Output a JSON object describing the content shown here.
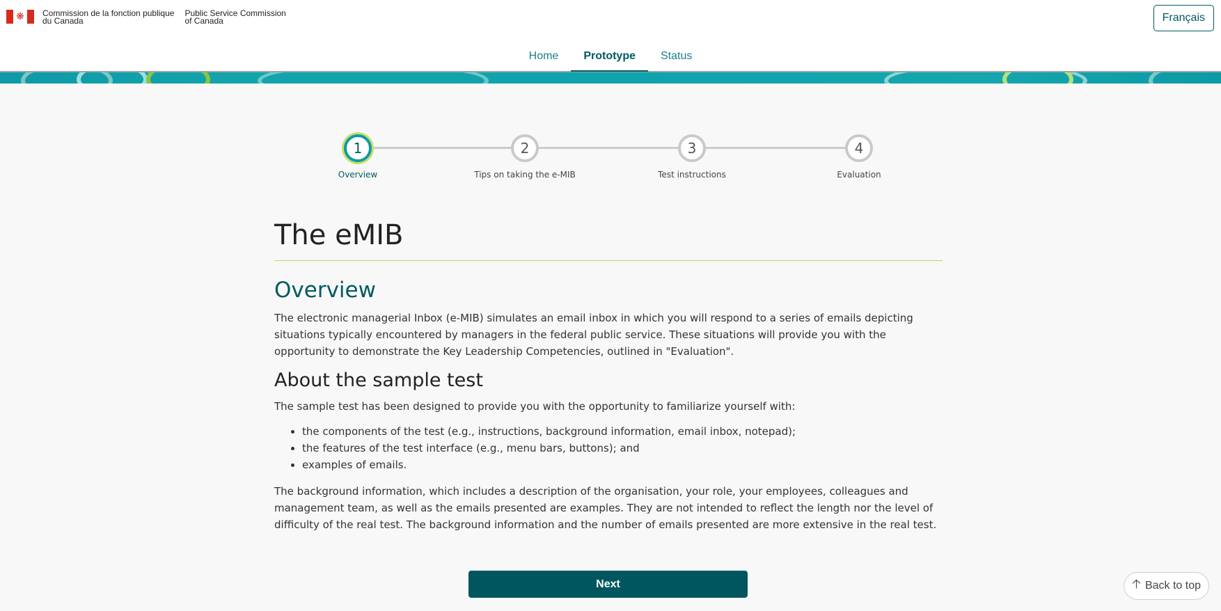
{
  "header": {
    "org_fr": "Commission de la fonction publique\ndu Canada",
    "org_en": "Public Service Commission\nof Canada",
    "flag_icon": "canada-flag-icon",
    "language_button": "Français"
  },
  "nav": {
    "tabs": [
      {
        "label": "Home",
        "active": false
      },
      {
        "label": "Prototype",
        "active": true
      },
      {
        "label": "Status",
        "active": false
      }
    ]
  },
  "stepper": {
    "current": 1,
    "steps": [
      {
        "number": "1",
        "label": "Overview"
      },
      {
        "number": "2",
        "label": "Tips on taking the e-MIB"
      },
      {
        "number": "3",
        "label": "Test instructions"
      },
      {
        "number": "4",
        "label": "Evaluation"
      }
    ]
  },
  "main": {
    "title": "The eMIB",
    "overview_heading": "Overview",
    "overview_text": "The electronic managerial Inbox (e-MIB) simulates an email inbox in which you will respond to a series of emails depicting situations typically encountered by managers in the federal public service. These situations will provide you with the opportunity to demonstrate the Key Leadership Competencies, outlined in \"Evaluation\".",
    "sample_heading": "About the sample test",
    "sample_intro": "The sample test has been designed to provide you with the opportunity to familiarize yourself with:",
    "sample_items": [
      "the components of the test (e.g., instructions, background information, email inbox, notepad);",
      "the features of the test interface (e.g., menu bars, buttons); and",
      "examples of emails."
    ],
    "background_text": "The background information, which includes a description of the organisation, your role, your employees, colleagues and management team, as well as the emails presented are examples. They are not intended to reflect the length nor the level of difficulty of the real test. The background information and the number of emails presented are more extensive in the real test."
  },
  "actions": {
    "next_label": "Next",
    "back_to_top_label": "Back to top",
    "back_to_top_icon": "arrow-up-icon"
  },
  "colors": {
    "primary": "#005a62",
    "accent_teal": "#0e9aa7",
    "accent_green": "#b8d66a"
  }
}
